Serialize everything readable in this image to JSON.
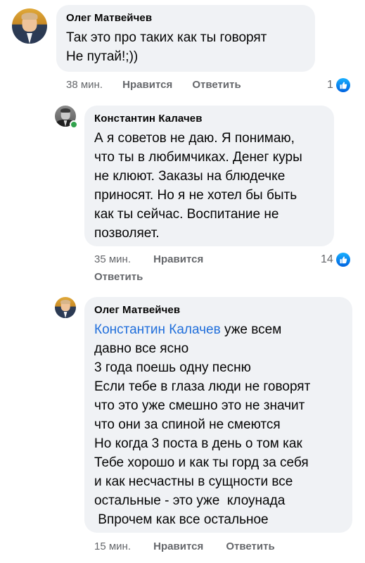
{
  "comments": [
    {
      "author": "Олег Матвейчев",
      "lines": [
        "Так это про таких как ты говорят",
        "Не путай!;))"
      ],
      "time": "38 мин.",
      "like_label": "Нравится",
      "reply_label": "Ответить",
      "reaction_count": "1"
    },
    {
      "author": "Константин Калачев",
      "lines": [
        "А я советов не даю. Я понимаю,",
        "что ты в любимчиках. Денег куры",
        "не клюют. Заказы на блюдечке",
        "приносят. Но я не хотел бы быть",
        "как ты сейчас. Воспитание не",
        "позволяет."
      ],
      "time": "35 мин.",
      "like_label": "Нравится",
      "reply_label": "Ответить",
      "reaction_count": "14"
    },
    {
      "author": "Олег Матвейчев",
      "mention": "Константин Калачев",
      "first_line_rest": " уже всем",
      "lines": [
        "давно все ясно",
        "3 года поешь одну песню",
        "Если тебе в глаза люди не говорят",
        "что это уже смешно это не значит",
        "что они за спиной не смеются",
        "Но когда 3 поста в день о том как",
        "Тебе хорошо и как ты горд за себя",
        "и как несчастны в сущности все",
        "остальные - это уже  клоунада",
        " Впрочем как все остальное"
      ],
      "time": "15 мин.",
      "like_label": "Нравится",
      "reply_label": "Ответить"
    }
  ],
  "icons": {
    "avatar": "profile-photo",
    "reaction": "like-icon",
    "presence": "online-status-dot"
  },
  "colors": {
    "bubble": "#f0f2f5",
    "mention": "#216fdb",
    "meta": "#65676b",
    "like_blue": "#1877f2",
    "online": "#31a24c"
  }
}
